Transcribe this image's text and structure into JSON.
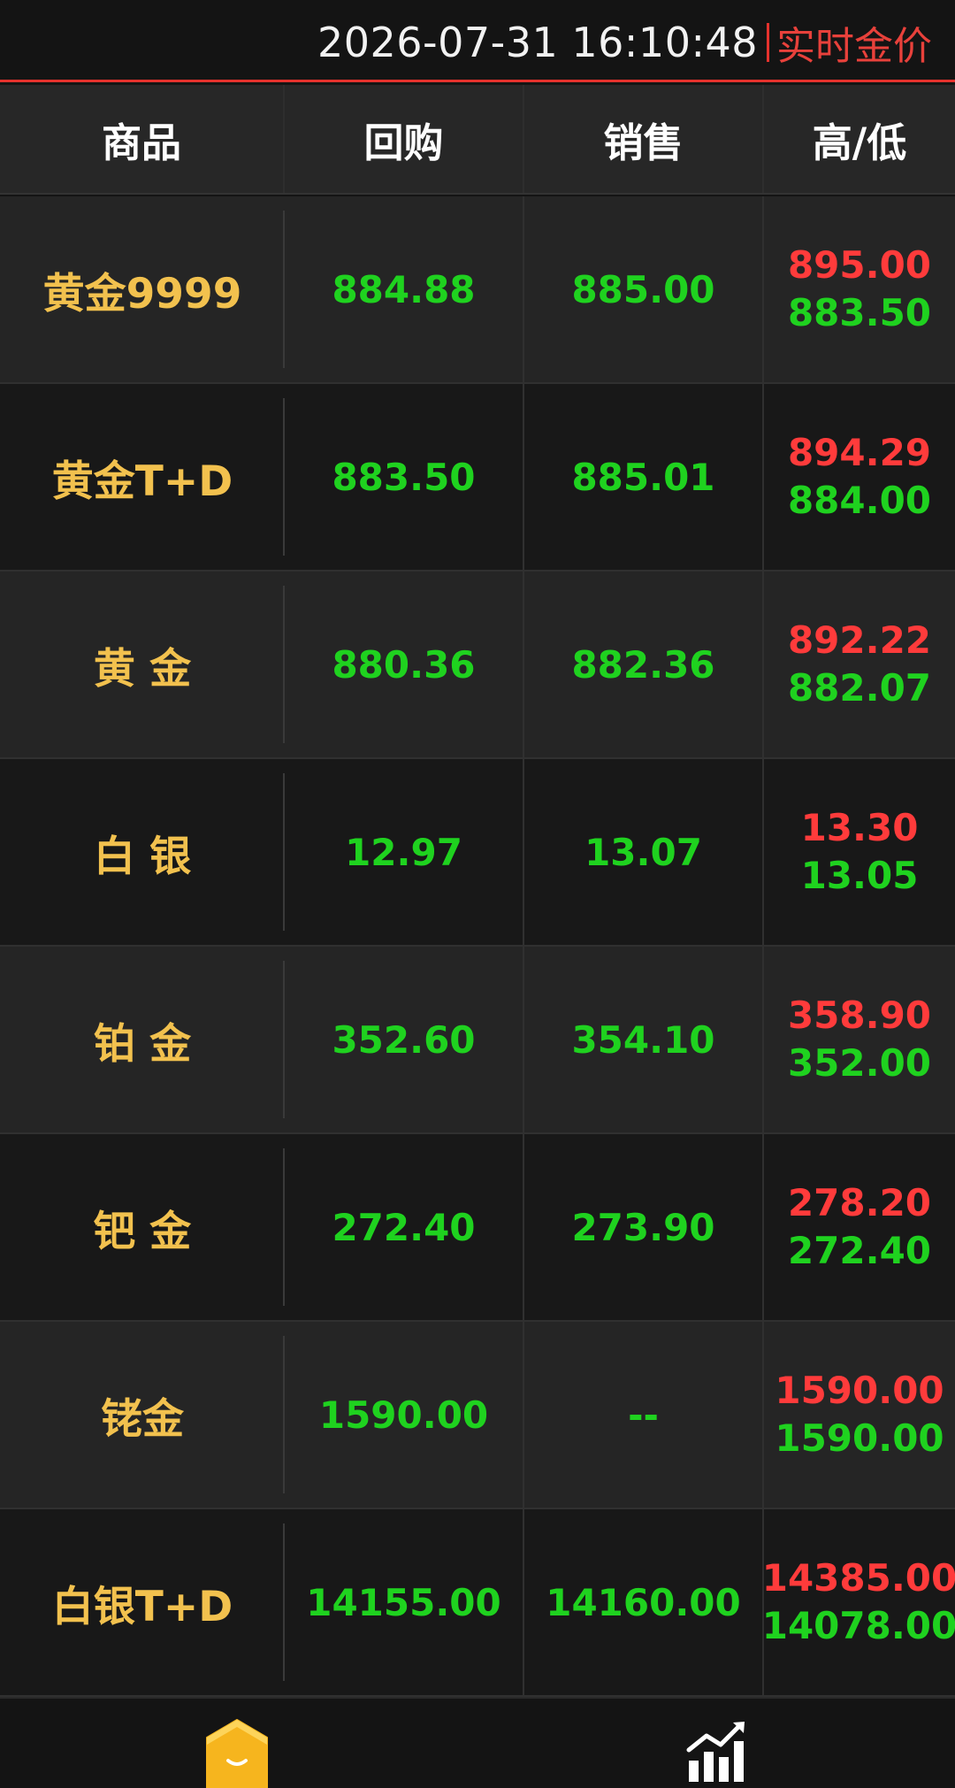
{
  "header": {
    "datetime": "2026-07-31 16:10:48",
    "title": "实时金价"
  },
  "table": {
    "columns": [
      "商品",
      "回购",
      "销售",
      "高/低"
    ],
    "rows": [
      {
        "name": "黄金9999",
        "buyback": "884.88",
        "sell": "885.00",
        "high": "895.00",
        "low": "883.50"
      },
      {
        "name": "黄金T+D",
        "buyback": "883.50",
        "sell": "885.01",
        "high": "894.29",
        "low": "884.00"
      },
      {
        "name": "黄 金",
        "buyback": "880.36",
        "sell": "882.36",
        "high": "892.22",
        "low": "882.07"
      },
      {
        "name": "白 银",
        "buyback": "12.97",
        "sell": "13.07",
        "high": "13.30",
        "low": "13.05"
      },
      {
        "name": "铂 金",
        "buyback": "352.60",
        "sell": "354.10",
        "high": "358.90",
        "low": "352.00"
      },
      {
        "name": "钯 金",
        "buyback": "272.40",
        "sell": "273.90",
        "high": "278.20",
        "low": "272.40"
      },
      {
        "name": "铑金",
        "buyback": "1590.00",
        "sell": "--",
        "high": "1590.00",
        "low": "1590.00"
      },
      {
        "name": "白银T+D",
        "buyback": "14155.00",
        "sell": "14160.00",
        "high": "14385.00",
        "low": "14078.00"
      }
    ]
  },
  "nav": {
    "home_icon": "home-icon",
    "chart_icon": "chart-icon"
  },
  "colors": {
    "accent_red": "#e5322d",
    "price_green": "#1fd21f",
    "price_red": "#ff3b3b",
    "name_gold": "#f2c14e"
  }
}
